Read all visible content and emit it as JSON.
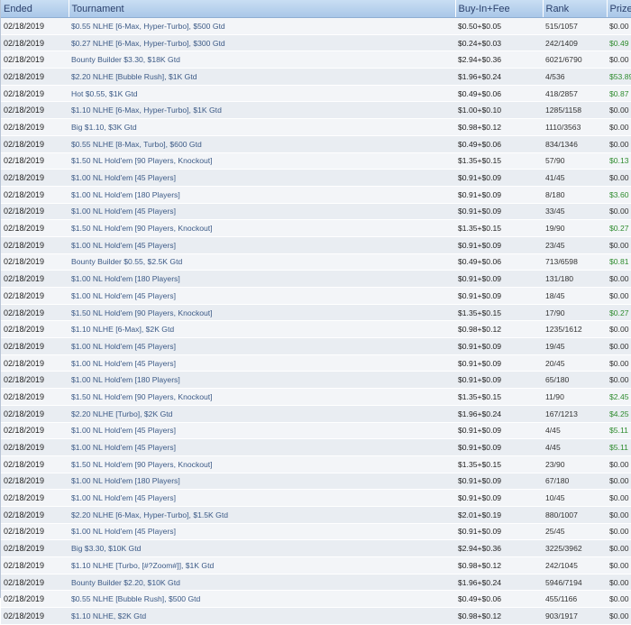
{
  "columns": [
    "Ended",
    "Tournament",
    "Buy-In+Fee",
    "Rank",
    "Prize"
  ],
  "rows": [
    [
      "02/18/2019",
      "$0.55 NLHE [6-Max, Hyper-Turbo], $500 Gtd",
      "$0.50+$0.05",
      "515/1057",
      "$0.00"
    ],
    [
      "02/18/2019",
      "$0.27 NLHE [6-Max, Hyper-Turbo], $300 Gtd",
      "$0.24+$0.03",
      "242/1409",
      "$0.49"
    ],
    [
      "02/18/2019",
      "Bounty Builder $3.30, $18K Gtd",
      "$2.94+$0.36",
      "6021/6790",
      "$0.00"
    ],
    [
      "02/18/2019",
      "$2.20 NLHE [Bubble Rush], $1K Gtd",
      "$1.96+$0.24",
      "4/536",
      "$53.89"
    ],
    [
      "02/18/2019",
      "Hot $0.55, $1K Gtd",
      "$0.49+$0.06",
      "418/2857",
      "$0.87"
    ],
    [
      "02/18/2019",
      "$1.10 NLHE [6-Max, Hyper-Turbo], $1K Gtd",
      "$1.00+$0.10",
      "1285/1158",
      "$0.00"
    ],
    [
      "02/18/2019",
      "Big $1.10, $3K Gtd",
      "$0.98+$0.12",
      "1110/3563",
      "$0.00"
    ],
    [
      "02/18/2019",
      "$0.55 NLHE [8-Max, Turbo], $600 Gtd",
      "$0.49+$0.06",
      "834/1346",
      "$0.00"
    ],
    [
      "02/18/2019",
      "$1.50 NL Hold'em [90 Players, Knockout]",
      "$1.35+$0.15",
      "57/90",
      "$0.13"
    ],
    [
      "02/18/2019",
      "$1.00 NL Hold'em [45 Players]",
      "$0.91+$0.09",
      "41/45",
      "$0.00"
    ],
    [
      "02/18/2019",
      "$1.00 NL Hold'em [180 Players]",
      "$0.91+$0.09",
      "8/180",
      "$3.60"
    ],
    [
      "02/18/2019",
      "$1.00 NL Hold'em [45 Players]",
      "$0.91+$0.09",
      "33/45",
      "$0.00"
    ],
    [
      "02/18/2019",
      "$1.50 NL Hold'em [90 Players, Knockout]",
      "$1.35+$0.15",
      "19/90",
      "$0.27"
    ],
    [
      "02/18/2019",
      "$1.00 NL Hold'em [45 Players]",
      "$0.91+$0.09",
      "23/45",
      "$0.00"
    ],
    [
      "02/18/2019",
      "Bounty Builder $0.55, $2.5K Gtd",
      "$0.49+$0.06",
      "713/6598",
      "$0.81"
    ],
    [
      "02/18/2019",
      "$1.00 NL Hold'em [180 Players]",
      "$0.91+$0.09",
      "131/180",
      "$0.00"
    ],
    [
      "02/18/2019",
      "$1.00 NL Hold'em [45 Players]",
      "$0.91+$0.09",
      "18/45",
      "$0.00"
    ],
    [
      "02/18/2019",
      "$1.50 NL Hold'em [90 Players, Knockout]",
      "$1.35+$0.15",
      "17/90",
      "$0.27"
    ],
    [
      "02/18/2019",
      "$1.10 NLHE [6-Max], $2K Gtd",
      "$0.98+$0.12",
      "1235/1612",
      "$0.00"
    ],
    [
      "02/18/2019",
      "$1.00 NL Hold'em [45 Players]",
      "$0.91+$0.09",
      "19/45",
      "$0.00"
    ],
    [
      "02/18/2019",
      "$1.00 NL Hold'em [45 Players]",
      "$0.91+$0.09",
      "20/45",
      "$0.00"
    ],
    [
      "02/18/2019",
      "$1.00 NL Hold'em [180 Players]",
      "$0.91+$0.09",
      "65/180",
      "$0.00"
    ],
    [
      "02/18/2019",
      "$1.50 NL Hold'em [90 Players, Knockout]",
      "$1.35+$0.15",
      "11/90",
      "$2.45"
    ],
    [
      "02/18/2019",
      "$2.20 NLHE [Turbo], $2K Gtd",
      "$1.96+$0.24",
      "167/1213",
      "$4.25"
    ],
    [
      "02/18/2019",
      "$1.00 NL Hold'em [45 Players]",
      "$0.91+$0.09",
      "4/45",
      "$5.11"
    ],
    [
      "02/18/2019",
      "$1.00 NL Hold'em [45 Players]",
      "$0.91+$0.09",
      "4/45",
      "$5.11"
    ],
    [
      "02/18/2019",
      "$1.50 NL Hold'em [90 Players, Knockout]",
      "$1.35+$0.15",
      "23/90",
      "$0.00"
    ],
    [
      "02/18/2019",
      "$1.00 NL Hold'em [180 Players]",
      "$0.91+$0.09",
      "67/180",
      "$0.00"
    ],
    [
      "02/18/2019",
      "$1.00 NL Hold'em [45 Players]",
      "$0.91+$0.09",
      "10/45",
      "$0.00"
    ],
    [
      "02/18/2019",
      "$2.20 NLHE [6-Max, Hyper-Turbo], $1.5K Gtd",
      "$2.01+$0.19",
      "880/1007",
      "$0.00"
    ],
    [
      "02/18/2019",
      "$1.00 NL Hold'em [45 Players]",
      "$0.91+$0.09",
      "25/45",
      "$0.00"
    ],
    [
      "02/18/2019",
      "Big $3.30, $10K Gtd",
      "$2.94+$0.36",
      "3225/3962",
      "$0.00"
    ],
    [
      "02/18/2019",
      "$1.10 NLHE [Turbo, [#?Zoom#]], $1K Gtd",
      "$0.98+$0.12",
      "242/1045",
      "$0.00"
    ],
    [
      "02/18/2019",
      "Bounty Builder $2.20, $10K Gtd",
      "$1.96+$0.24",
      "5946/7194",
      "$0.00"
    ],
    [
      "02/18/2019",
      "$0.55 NLHE [Bubble Rush], $500 Gtd",
      "$0.49+$0.06",
      "455/1166",
      "$0.00"
    ],
    [
      "02/18/2019",
      "$1.10 NLHE, $2K Gtd",
      "$0.98+$0.12",
      "903/1917",
      "$0.00"
    ]
  ]
}
